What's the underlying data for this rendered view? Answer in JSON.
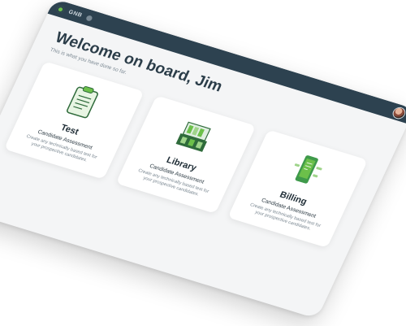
{
  "app": {
    "brand": "GNB"
  },
  "page": {
    "title": "Welcome on board, Jim",
    "subtitle": "This is what you have done so far."
  },
  "cards": [
    {
      "title": "Test",
      "subtitle": "Candidate Assessment",
      "description": "Create any technically based test for your prospective candidates.",
      "icon": "clipboard-icon"
    },
    {
      "title": "Library",
      "subtitle": "Candidate Assessment",
      "description": "Create any technically based test for your prospective candidates.",
      "icon": "library-icon"
    },
    {
      "title": "Billing",
      "subtitle": "Candidate Assessment",
      "description": "Create any technically based test for your prospective candidates.",
      "icon": "billing-phone-icon"
    }
  ],
  "colors": {
    "topbar": "#2d4250",
    "accent": "#6cc04a",
    "title": "#2b3d49"
  }
}
